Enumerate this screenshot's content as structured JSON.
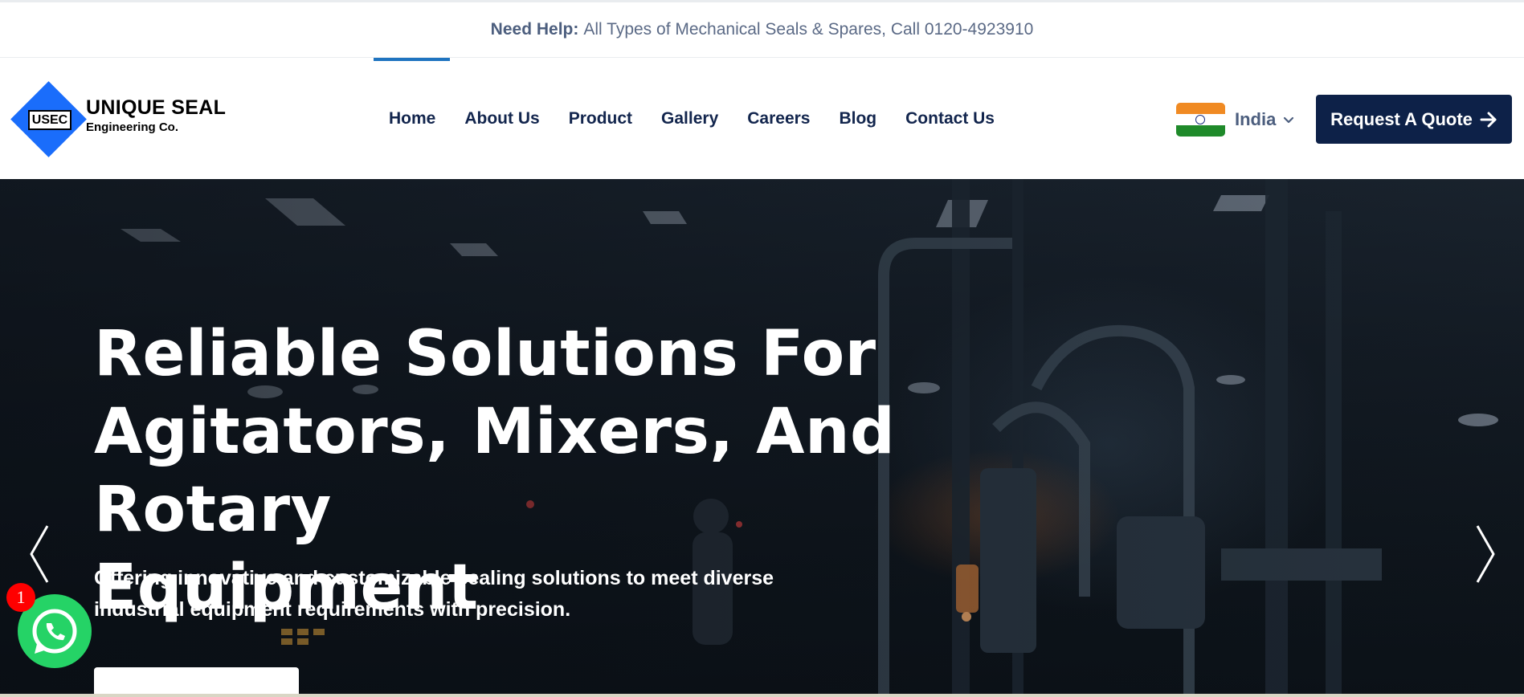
{
  "topbar": {
    "help_label": "Need Help:",
    "help_text": "All Types of Mechanical Seals & Spares, Call 0120-4923910"
  },
  "logo": {
    "badge": "USEC",
    "brand": "UNIQUE SEAL",
    "sub": "Engineering Co."
  },
  "nav": {
    "active": "Home",
    "items": [
      "Home",
      "About Us",
      "Product",
      "Gallery",
      "Careers",
      "Blog",
      "Contact Us"
    ]
  },
  "locale": {
    "country": "India",
    "flag_icon": "india-flag-icon"
  },
  "quote_button": {
    "label": "Request A Quote",
    "icon": "arrow-right-icon"
  },
  "hero": {
    "title_lines": [
      "Reliable Solutions For",
      "Agitators, Mixers, And Rotary",
      "Equipment"
    ],
    "subtitle": "Offering innovative and customizable sealing solutions to meet diverse industrial equipment requirements with precision.",
    "cta_label": ""
  },
  "whatsapp": {
    "badge_count": "1",
    "icon": "whatsapp-icon"
  },
  "colors": {
    "navy": "#0d2148",
    "active_nav": "#1f74c0",
    "logo_blue": "#1a6dfb",
    "whatsapp_green": "#25d366",
    "badge_red": "#ff0000"
  }
}
